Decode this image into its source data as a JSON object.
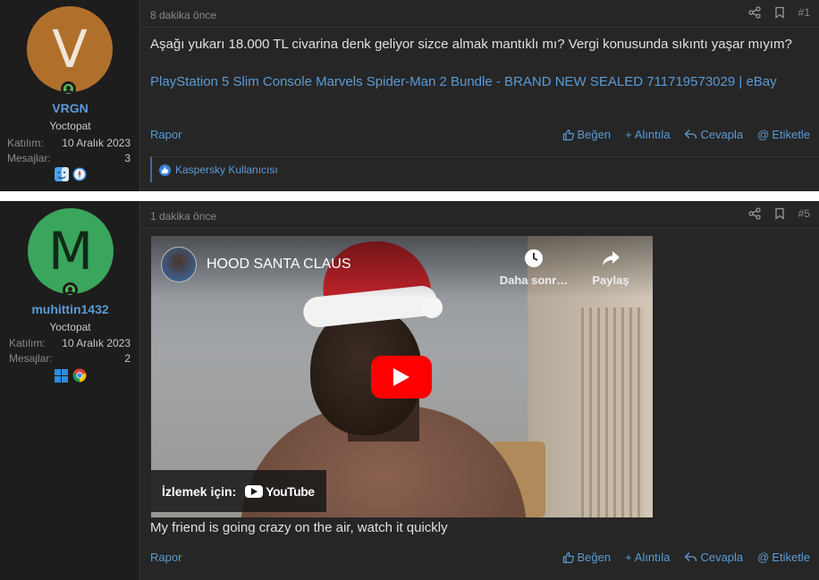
{
  "posts": [
    {
      "avatar_letter": "V",
      "avatar_color": "#b0702c",
      "username": "VRGN",
      "user_title": "Yoctopat",
      "joined_label": "Katılım:",
      "joined_value": "10 Aralık 2023",
      "messages_label": "Mesajlar:",
      "messages_value": "3",
      "badges": [
        "finder-icon",
        "safari-icon"
      ],
      "date": "8 dakika önce",
      "post_number": "#1",
      "text": "Aşağı yukarı 18.000 TL civarina denk geliyor sizce almak mantıklı mı? Vergi konusunda sıkıntı yaşar mıyım?",
      "link": "PlayStation 5 Slim Console Marvels Spider-Man 2 Bundle - BRAND NEW SEALED 711719573029 | eBay",
      "report_label": "Rapor",
      "reaction_text": "Kaspersky Kullanıcısı"
    },
    {
      "avatar_letter": "M",
      "avatar_color": "#3aa55c",
      "username": "muhittin1432",
      "user_title": "Yoctopat",
      "joined_label": "Katılım:",
      "joined_value": "10 Aralık 2023",
      "messages_label": "Mesajlar:",
      "messages_value": "2",
      "badges": [
        "windows-icon",
        "chrome-icon"
      ],
      "date": "1 dakika önce",
      "post_number": "#5",
      "video": {
        "title": "HOOD SANTA CLAUS",
        "watch_later": "Daha sonr…",
        "share": "Paylaş",
        "watch_on": "İzlemek için:",
        "youtube": "YouTube"
      },
      "text": "My friend is going crazy on the air, watch it quickly",
      "report_label": "Rapor"
    }
  ],
  "actions": {
    "like": "Beğen",
    "quote": "Alıntıla",
    "reply": "Cevapla",
    "tag": "Etiketle"
  }
}
